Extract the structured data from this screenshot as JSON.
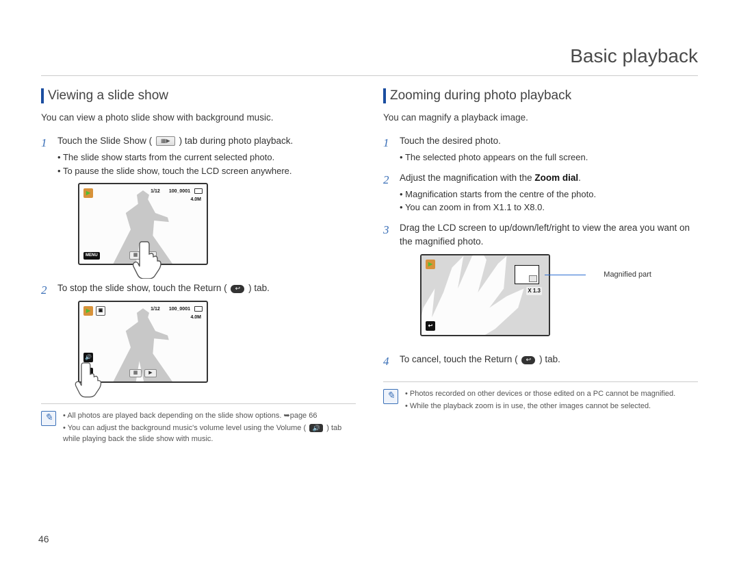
{
  "page": {
    "title": "Basic playback",
    "number": "46"
  },
  "left": {
    "heading": "Viewing a slide show",
    "intro": "You can view a photo slide show with background music.",
    "step1_pre": "Touch the Slide Show (",
    "step1_post": ") tab during photo playback.",
    "step1_b1": "The slide show starts from the current selected photo.",
    "step1_b2": "To pause the slide show, touch the LCD screen anywhere.",
    "step2_pre": "To stop the slide show, touch the Return (",
    "step2_post": ") tab.",
    "note1_pre": "All photos are played back depending on the slide show options. ",
    "note1_post": "page 66",
    "note2_pre": "You can adjust the background music's volume level using the Volume (",
    "note2_post": ") tab while playing back the slide show with music.",
    "lcd": {
      "count": "1/12",
      "file": "100_0001",
      "size": "4.0M",
      "menu": "MENU"
    }
  },
  "right": {
    "heading": "Zooming during photo playback",
    "intro": "You can magnify a playback image.",
    "step1": "Touch the desired photo.",
    "step1_b1": "The selected photo appears on the full screen.",
    "step2_pre": "Adjust the magnification with the ",
    "step2_bold": "Zoom dial",
    "step2_post": ".",
    "step2_b1": "Magnification starts from the centre of the photo.",
    "step2_b2": "You can zoom in from X1.1 to X8.0.",
    "step3": "Drag the LCD screen to up/down/left/right to view the area you want on the magnified photo.",
    "step4_pre": "To cancel, touch the Return (",
    "step4_post": ") tab.",
    "callout": "Magnified part",
    "mag_label": "X 1.3",
    "note1": "Photos recorded on other devices or those edited on a PC cannot be magnified.",
    "note2": "While the playback zoom is in use, the other images cannot be selected."
  },
  "icons": {
    "slideshow_tab": "▦▶",
    "return": "↩",
    "volume": "🔊",
    "link_arrow": "➥"
  }
}
